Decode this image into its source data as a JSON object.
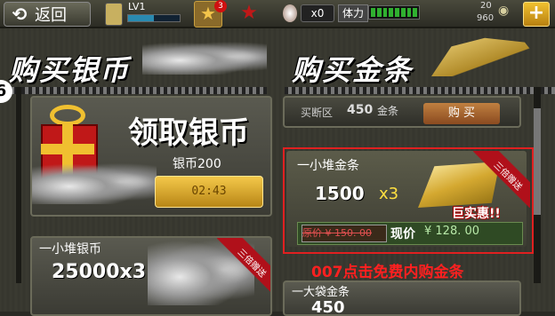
{
  "top_bar": {
    "back_label": "返回",
    "back_arrow": "⟲",
    "level_label": "LV1",
    "level_progress": 0.5,
    "star_badge_count": "3",
    "egg_count": "x0",
    "stamina_label": "体力",
    "stamina_progress": 1.0,
    "resource_top": "20",
    "resource_bottom": "960",
    "plus_label": "+"
  },
  "sections": {
    "silver_title": "购买银币",
    "gold_title": "购买金条",
    "side_marker": "6"
  },
  "claim_card": {
    "title": "领取银币",
    "amount": "银币200",
    "timer": "02:43"
  },
  "silver_card2": {
    "name": "一小堆银币",
    "amount": "25000x3",
    "ribbon": "三倍赠送"
  },
  "gold_card_top": {
    "label": "买断区",
    "amount": "450",
    "unit": "金条",
    "button": "购 买"
  },
  "gold_card": {
    "name": "一小堆金条",
    "amount": "1500",
    "multiplier": "x3",
    "promo": "巨实惠!!",
    "original_price": "原价 ¥ 150. 00",
    "now_label": "现价",
    "now_price": "¥ 128. 00",
    "ribbon": "三倍赠送"
  },
  "overlay": {
    "text": "007点击免费内购金条"
  },
  "gold_card_bottom": {
    "name": "一大袋金条",
    "amount": "450"
  },
  "colors": {
    "accent_gold": "#f0c030",
    "highlight_red": "#e02020",
    "stamina_green": "#30b030"
  }
}
